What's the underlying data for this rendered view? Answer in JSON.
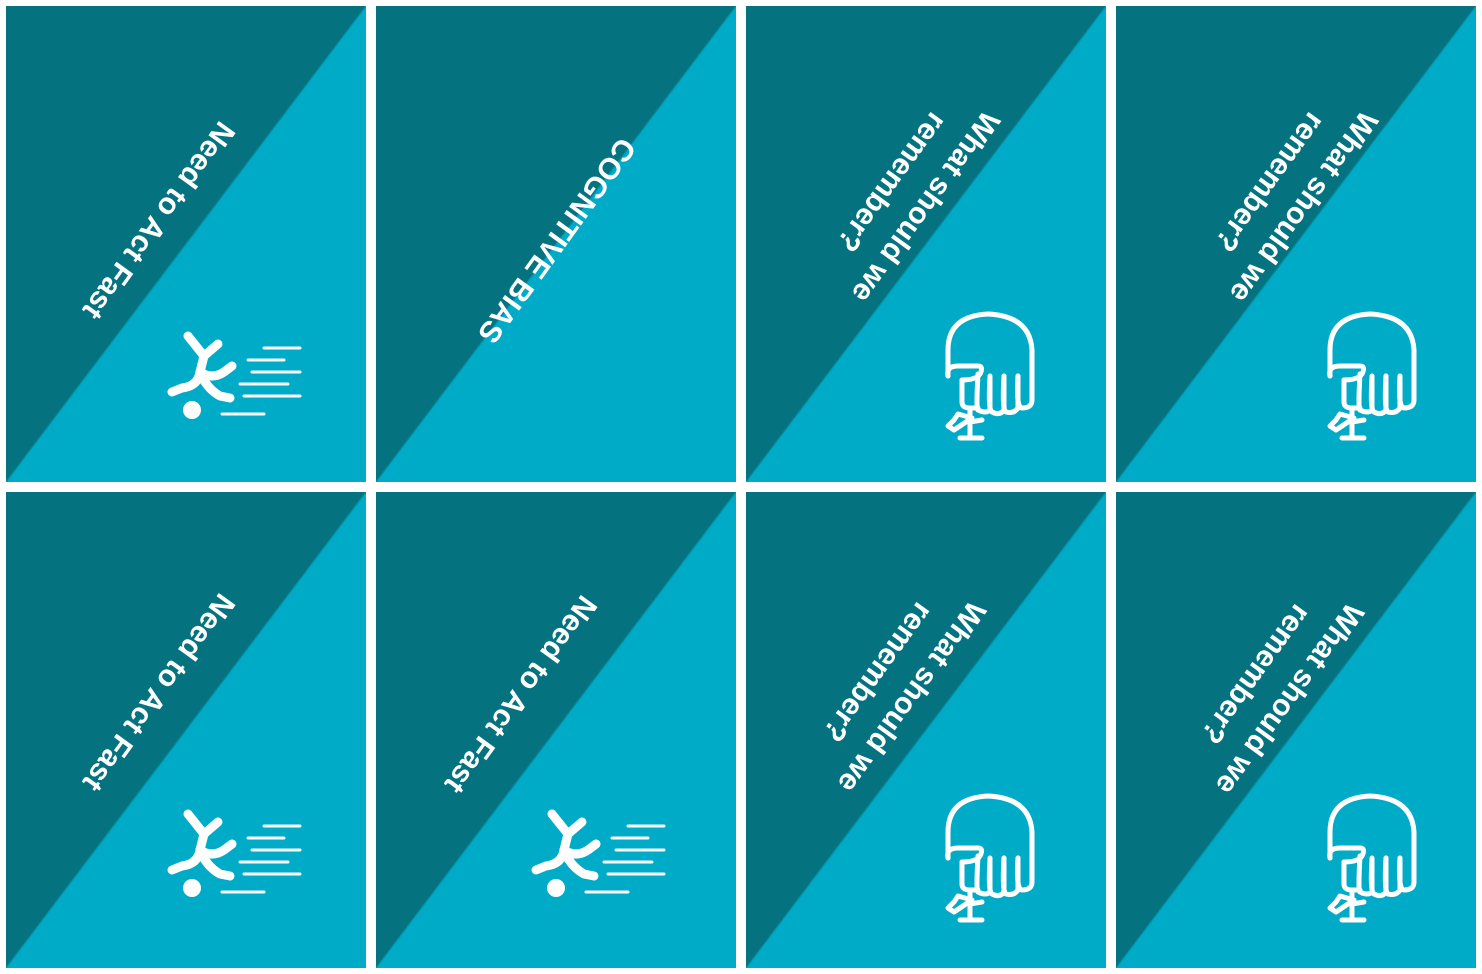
{
  "colors": {
    "dark": "#05737f",
    "light": "#00abc8",
    "text": "#ffffff"
  },
  "cards": [
    {
      "lines": [
        "Need to Act Fast"
      ],
      "icon": "falling-person-icon"
    },
    {
      "lines": [
        "COGNITIVE BIAS"
      ],
      "icon": ""
    },
    {
      "lines": [
        "What should we",
        "remember?"
      ],
      "icon": "fist-ribbon-icon"
    },
    {
      "lines": [
        "What should we",
        "remember?"
      ],
      "icon": "fist-ribbon-icon"
    },
    {
      "lines": [
        "Need to Act Fast"
      ],
      "icon": "falling-person-icon"
    },
    {
      "lines": [
        "Need to Act Fast"
      ],
      "icon": "falling-person-icon"
    },
    {
      "lines": [
        "What should we",
        "remember?"
      ],
      "icon": "fist-ribbon-icon"
    },
    {
      "lines": [
        "What should we",
        "remember?"
      ],
      "icon": "fist-ribbon-icon"
    }
  ]
}
